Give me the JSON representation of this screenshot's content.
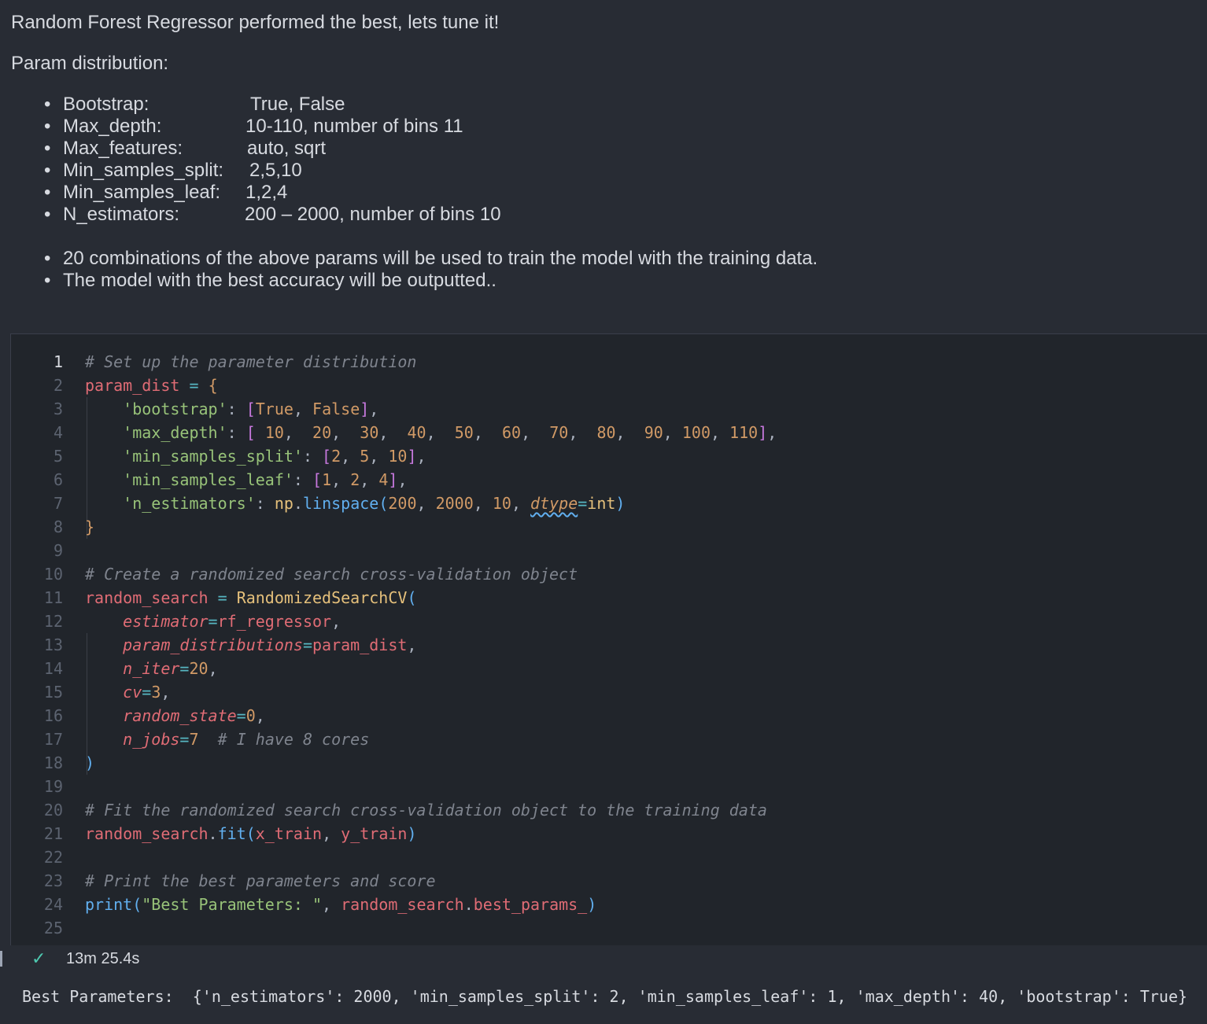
{
  "markdown": {
    "heading": "Random Forest Regressor performed the best, lets tune it!",
    "param_title": "Param distribution:",
    "params": [
      {
        "key": "Bootstrap:",
        "value": "True, False"
      },
      {
        "key": "Max_depth:",
        "value": "10-110, number of bins 11"
      },
      {
        "key": "Max_features:",
        "value": "auto, sqrt"
      },
      {
        "key": "Min_samples_split:",
        "value": "2,5,10"
      },
      {
        "key": "Min_samples_leaf:",
        "value": "1,2,4"
      },
      {
        "key": "N_estimators:",
        "value": "200 – 2000, number of bins 10"
      }
    ],
    "notes": [
      "20 combinations of the above params will be used to train the model with the training data.",
      "The model with the best accuracy will be outputted.."
    ],
    "bullet": "•"
  },
  "code_cell": {
    "line_numbers": [
      "1",
      "2",
      "3",
      "4",
      "5",
      "6",
      "7",
      "8",
      "9",
      "10",
      "11",
      "12",
      "13",
      "14",
      "15",
      "16",
      "17",
      "18",
      "19",
      "20",
      "21",
      "22",
      "23",
      "24",
      "25"
    ],
    "active_line": 1,
    "lines": [
      "# Set up the parameter distribution",
      "param_dist = {",
      "    'bootstrap': [True, False],",
      "    'max_depth': [ 10,  20,  30,  40,  50,  60,  70,  80,  90, 100, 110],",
      "    'min_samples_split': [2, 5, 10],",
      "    'min_samples_leaf': [1, 2, 4],",
      "    'n_estimators': np.linspace(200, 2000, 10, dtype=int)",
      "}",
      "",
      "# Create a randomized search cross-validation object",
      "random_search = RandomizedSearchCV(",
      "    estimator=rf_regressor,",
      "    param_distributions=param_dist,",
      "    n_iter=20,",
      "    cv=3,",
      "    random_state=0,",
      "    n_jobs=7  # I have 8 cores",
      ")",
      "",
      "# Fit the randomized search cross-validation object to the training data",
      "random_search.fit(x_train, y_train)",
      "",
      "# Print the best parameters and score",
      "print(\"Best Parameters: \", random_search.best_params_)",
      ""
    ]
  },
  "execution": {
    "status_icon": "check-icon",
    "check_glyph": "✓",
    "duration": "13m 25.4s"
  },
  "output": {
    "text": "Best Parameters:  {'n_estimators': 2000, 'min_samples_split': 2, 'min_samples_leaf': 1, 'max_depth': 40, 'bootstrap': True}"
  },
  "colors": {
    "background": "#282c34",
    "cell_background": "#21252b",
    "success": "#4ec9b0"
  }
}
